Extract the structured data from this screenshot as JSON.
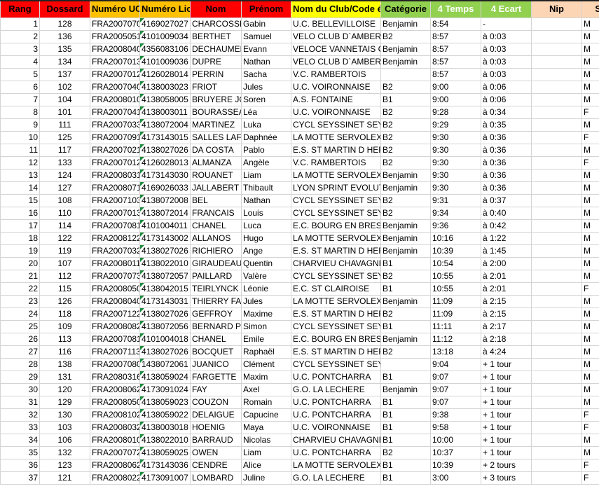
{
  "header": {
    "columns": [
      {
        "label": "Rang",
        "bg": "#ff0000",
        "color": "#000000"
      },
      {
        "label": "Dossard",
        "bg": "#ff0000",
        "color": "#000000"
      },
      {
        "label": "Numéro UCI",
        "bg": "#ffc000",
        "color": "#000000"
      },
      {
        "label": "Numéro Licence",
        "bg": "#ffc000",
        "color": "#000000"
      },
      {
        "label": "Nom",
        "bg": "#ff0000",
        "color": "#000000"
      },
      {
        "label": "Prénom",
        "bg": "#ff0000",
        "color": "#000000"
      },
      {
        "label": "Nom du Club/Code équipe",
        "bg": "#ffff00",
        "color": "#000000"
      },
      {
        "label": "Catégorie",
        "bg": "#92d050",
        "color": "#000000"
      },
      {
        "label": "4 Temps",
        "bg": "#92d050",
        "color": "#ffffff"
      },
      {
        "label": "4 Ecart",
        "bg": "#92d050",
        "color": "#ffffff"
      },
      {
        "label": "Nip",
        "bg": "#fcd5b4",
        "color": "#000000"
      },
      {
        "label": "Sexe",
        "bg": "#fcd5b4",
        "color": "#000000"
      }
    ]
  },
  "rows": [
    [
      "1",
      "128",
      "FRA2007070",
      "4169027027",
      "CHARCOSSET",
      "Gabin",
      "U.C. BELLEVILLOISE",
      "Benjamin",
      "8:54",
      "-",
      "",
      "M"
    ],
    [
      "2",
      "136",
      "FRA2005051",
      "4101009034",
      "BERTHET",
      "Samuel",
      "VELO CLUB D`AMBERIEU",
      "B2",
      "8:57",
      "à 0:03",
      "",
      "M"
    ],
    [
      "3",
      "135",
      "FRA2008040",
      "4356083106",
      "DECHAUMEL",
      "Evann",
      "VELOCE VANNETAIS CYC",
      "Benjamin",
      "8:57",
      "à 0:03",
      "",
      "M"
    ],
    [
      "4",
      "134",
      "FRA2007013",
      "4101009036",
      "DUPRE",
      "Nathan",
      "VELO CLUB D`AMBERIEU",
      "Benjamin",
      "8:57",
      "à 0:03",
      "",
      "M"
    ],
    [
      "5",
      "137",
      "FRA2007012",
      "4126028014",
      "PERRIN",
      "Sacha",
      "V.C. RAMBERTOIS",
      "",
      "8:57",
      "à 0:03",
      "",
      "M"
    ],
    [
      "6",
      "102",
      "FRA2007040",
      "4138003023",
      "FRIOT",
      "Jules",
      "U.C. VOIRONNAISE",
      "B2",
      "9:00",
      "à 0:06",
      "",
      "M"
    ],
    [
      "7",
      "104",
      "FRA2008010",
      "4138058005",
      "BRUYERE JOUBERT",
      "Soren",
      "A.S. FONTAINE",
      "B1",
      "9:00",
      "à 0:06",
      "",
      "M"
    ],
    [
      "8",
      "101",
      "FRA2007041",
      "4138003011",
      "BOURASSEAU",
      "Léa",
      "U.C. VOIRONNAISE",
      "B2",
      "9:28",
      "à 0:34",
      "",
      "F"
    ],
    [
      "9",
      "111",
      "FRA2007033",
      "4138072004",
      "MARTINEZ",
      "Luka",
      "CYCL SEYSSINET SEYSSINS",
      "B2",
      "9:29",
      "à 0:35",
      "",
      "M"
    ],
    [
      "10",
      "125",
      "FRA2007091",
      "4173143015",
      "SALLES LAFONT",
      "Daphnée",
      "LA MOTTE SERVOLEX CYCLISME",
      "B2",
      "9:30",
      "à 0:36",
      "",
      "F"
    ],
    [
      "11",
      "117",
      "FRA2007021",
      "4138027026",
      "DA COSTA",
      "Pablo",
      "E.S. ST MARTIN D HERES",
      "B2",
      "9:30",
      "à 0:36",
      "",
      "M"
    ],
    [
      "12",
      "133",
      "FRA2007012",
      "4126028013",
      "ALMANZA",
      "Angèle",
      "V.C. RAMBERTOIS",
      "B2",
      "9:30",
      "à 0:36",
      "",
      "F"
    ],
    [
      "13",
      "124",
      "FRA2008031",
      "4173143030",
      "ROUANET",
      "Liam",
      "LA MOTTE SERVOLEX CYCLISME",
      "Benjamin",
      "9:30",
      "à 0:36",
      "",
      "M"
    ],
    [
      "14",
      "127",
      "FRA2008071",
      "4169026033",
      "JALLABERT",
      "Thibault",
      "LYON SPRINT EVOLUTION",
      "Benjamin",
      "9:30",
      "à 0:36",
      "",
      "M"
    ],
    [
      "15",
      "108",
      "FRA2007103",
      "4138072008",
      "BEL",
      "Nathan",
      "CYCL SEYSSINET SEYSSINS",
      "B2",
      "9:31",
      "à 0:37",
      "",
      "M"
    ],
    [
      "16",
      "110",
      "FRA2007013",
      "4138072014",
      "FRANCAIS",
      "Louis",
      "CYCL SEYSSINET SEYSSINS",
      "B2",
      "9:34",
      "à 0:40",
      "",
      "M"
    ],
    [
      "17",
      "114",
      "FRA2007081",
      "4101004011",
      "CHANEL",
      "Luca",
      "E.C. BOURG EN BRESSE",
      "Benjamin",
      "9:36",
      "à 0:42",
      "",
      "M"
    ],
    [
      "18",
      "122",
      "FRA2008122",
      "4173143002",
      "ALLANOS",
      "Hugo",
      "LA MOTTE SERVOLEX CYCLISME",
      "Benjamin",
      "10:16",
      "à 1:22",
      "",
      "M"
    ],
    [
      "19",
      "119",
      "FRA2007032",
      "4138027026",
      "RICHIERO",
      "Ange",
      "E.S. ST MARTIN D HERES",
      "Benjamin",
      "10:39",
      "à 1:45",
      "",
      "M"
    ],
    [
      "20",
      "107",
      "FRA2008011",
      "4138022010",
      "GIRAUDEAU",
      "Quentin",
      "CHARVIEU CHAVAGNEUX",
      "B1",
      "10:54",
      "à 2:00",
      "",
      "M"
    ],
    [
      "21",
      "112",
      "FRA2007073",
      "4138072057",
      "PAILLARD",
      "Valère",
      "CYCL SEYSSINET SEYSSINS",
      "B2",
      "10:55",
      "à 2:01",
      "",
      "M"
    ],
    [
      "22",
      "115",
      "FRA2008050",
      "4138042015",
      "TEIRLYNCK",
      "Léonie",
      "E.C. ST CLAIROISE",
      "B1",
      "10:55",
      "à 2:01",
      "",
      "F"
    ],
    [
      "23",
      "126",
      "FRA2008040",
      "4173143031",
      "THIERRY FALCOZ",
      "Jules",
      "LA MOTTE SERVOLEX CYCLISME",
      "Benjamin",
      "11:09",
      "à 2:15",
      "",
      "M"
    ],
    [
      "24",
      "118",
      "FRA2007122",
      "4138027026",
      "GEFFROY",
      "Maxime",
      "E.S. ST MARTIN D HERES",
      "B2",
      "11:09",
      "à 2:15",
      "",
      "M"
    ],
    [
      "25",
      "109",
      "FRA2008082",
      "4138072056",
      "BERNARD PEYRE",
      "Simon",
      "CYCL SEYSSINET SEYSSINS",
      "B1",
      "11:11",
      "à 2:17",
      "",
      "M"
    ],
    [
      "26",
      "113",
      "FRA2007081",
      "4101004018",
      "CHANEL",
      "Emile",
      "E.C. BOURG EN BRESSE",
      "Benjamin",
      "11:12",
      "à 2:18",
      "",
      "M"
    ],
    [
      "27",
      "116",
      "FRA2007113",
      "4138027026",
      "BOCQUET",
      "Raphaël",
      "E.S. ST MARTIN D HERES",
      "B2",
      "13:18",
      "à 4:24",
      "",
      "M"
    ],
    [
      "28",
      "138",
      "FRA2007080",
      "1438072061",
      "JUANICO",
      "Clément",
      "CYCL SEYSSINET SEYSSINS",
      "",
      "9:04",
      "+ 1 tour",
      "",
      "M"
    ],
    [
      "29",
      "131",
      "FRA2080316",
      "4138059024",
      "FARGETTE",
      "Maxim",
      "U.C. PONTCHARRA",
      "B1",
      "9:07",
      "+ 1 tour",
      "",
      "M"
    ],
    [
      "30",
      "120",
      "FRA2008062",
      "4173091024",
      "FAY",
      "Axel",
      "G.O. LA LECHERE",
      "Benjamin",
      "9:07",
      "+ 1 tour",
      "",
      "M"
    ],
    [
      "31",
      "129",
      "FRA2008050",
      "4138059023",
      "COUZON",
      "Romain",
      "U.C. PONTCHARRA",
      "B1",
      "9:07",
      "+ 1 tour",
      "",
      "M"
    ],
    [
      "32",
      "130",
      "FRA2008102",
      "4138059022",
      "DELAIGUE",
      "Capucine",
      "U.C. PONTCHARRA",
      "B1",
      "9:38",
      "+ 1 tour",
      "",
      "F"
    ],
    [
      "33",
      "103",
      "FRA2008032",
      "4138003018",
      "HOENIG",
      "Maya",
      "U.C. VOIRONNAISE",
      "B1",
      "9:58",
      "+ 1 tour",
      "",
      "F"
    ],
    [
      "34",
      "106",
      "FRA2008010",
      "4138022010",
      "BARRAUD",
      "Nicolas",
      "CHARVIEU CHAVAGNEUX",
      "B1",
      "10:00",
      "+ 1 tour",
      "",
      "M"
    ],
    [
      "35",
      "132",
      "FRA2007072",
      "4138059025",
      "OWEN",
      "Liam",
      "U.C. PONTCHARRA",
      "B2",
      "10:37",
      "+ 1 tour",
      "",
      "M"
    ],
    [
      "36",
      "123",
      "FRA2008062",
      "4173143036",
      "CENDRE",
      "Alice",
      "LA MOTTE SERVOLEX CYCLISME",
      "B1",
      "10:39",
      "+ 2 tours",
      "",
      "F"
    ],
    [
      "37",
      "121",
      "FRA2008022",
      "4173091007",
      "LOMBARD",
      "Juline",
      "G.O. LA LECHERE",
      "B1",
      "3:00",
      "+ 3 tours",
      "",
      "F"
    ]
  ]
}
